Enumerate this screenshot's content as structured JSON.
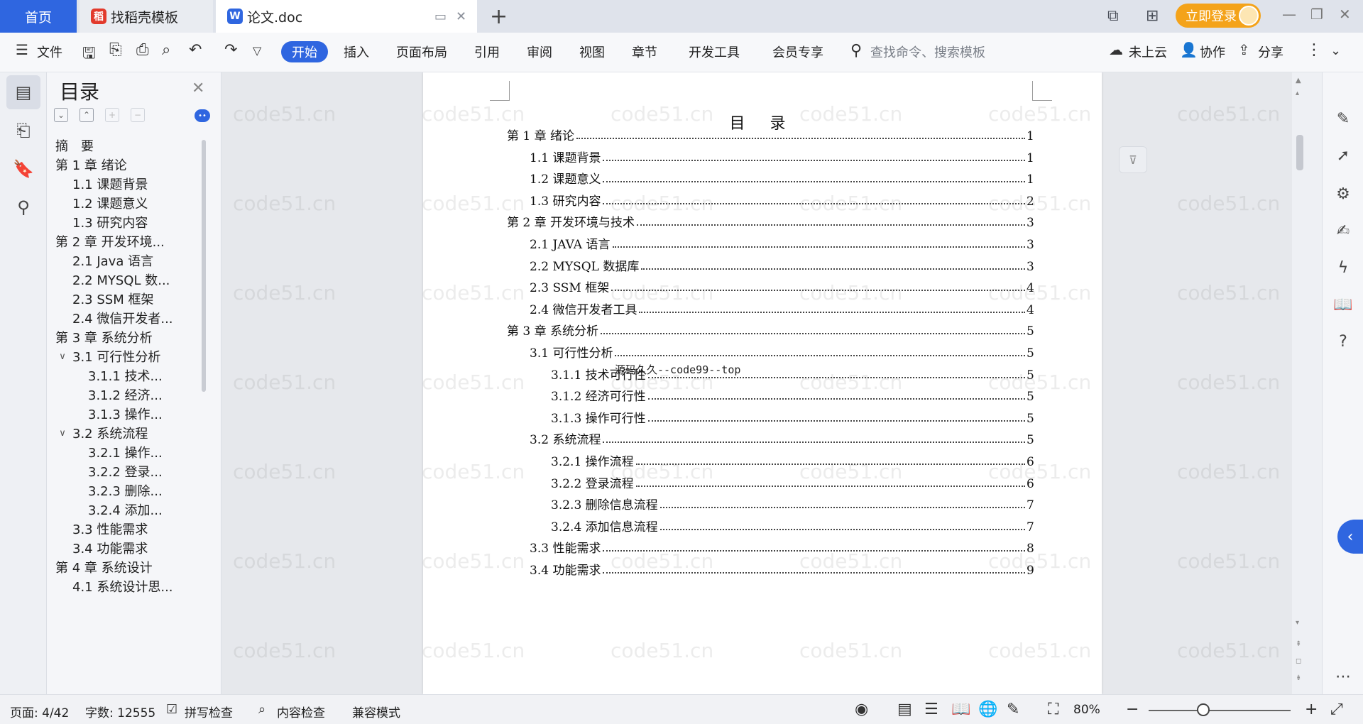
{
  "tabs": {
    "home": "首页",
    "template": "找稻壳模板",
    "doc": "论文.doc",
    "login": "立即登录"
  },
  "menu": {
    "file": "文件",
    "start": "开始",
    "insert": "插入",
    "layout": "页面布局",
    "reference": "引用",
    "review": "审阅",
    "view": "视图",
    "chapter": "章节",
    "devtools": "开发工具",
    "vip": "会员专享",
    "search_placeholder": "查找命令、搜索模板",
    "cloud": "未上云",
    "collab": "协作",
    "share": "分享"
  },
  "toc_panel": {
    "title": "目录",
    "items": [
      {
        "label": "摘　要",
        "level": 0,
        "chev": ""
      },
      {
        "label": "第 1 章  绪论",
        "level": 0,
        "chev": "v"
      },
      {
        "label": "1.1  课题背景",
        "level": 1,
        "chev": ""
      },
      {
        "label": "1.2  课题意义",
        "level": 1,
        "chev": ""
      },
      {
        "label": "1.3  研究内容",
        "level": 1,
        "chev": ""
      },
      {
        "label": "第 2 章  开发环境...",
        "level": 0,
        "chev": "v"
      },
      {
        "label": "2.1 Java 语言",
        "level": 1,
        "chev": ""
      },
      {
        "label": "2.2 MYSQL 数...",
        "level": 1,
        "chev": ""
      },
      {
        "label": "2.3 SSM 框架",
        "level": 1,
        "chev": ""
      },
      {
        "label": "2.4 微信开发者...",
        "level": 1,
        "chev": ""
      },
      {
        "label": "第 3 章  系统分析",
        "level": 0,
        "chev": "v"
      },
      {
        "label": "3.1  可行性分析",
        "level": 1,
        "chev": "v"
      },
      {
        "label": "3.1.1  技术...",
        "level": 2,
        "chev": ""
      },
      {
        "label": "3.1.2  经济...",
        "level": 2,
        "chev": ""
      },
      {
        "label": "3.1.3  操作...",
        "level": 2,
        "chev": ""
      },
      {
        "label": "3.2  系统流程",
        "level": 1,
        "chev": "v"
      },
      {
        "label": "3.2.1  操作...",
        "level": 2,
        "chev": ""
      },
      {
        "label": "3.2.2  登录...",
        "level": 2,
        "chev": ""
      },
      {
        "label": "3.2.3  删除...",
        "level": 2,
        "chev": ""
      },
      {
        "label": "3.2.4  添加...",
        "level": 2,
        "chev": ""
      },
      {
        "label": "3.3  性能需求",
        "level": 1,
        "chev": ""
      },
      {
        "label": "3.4  功能需求",
        "level": 1,
        "chev": ""
      },
      {
        "label": "第 4 章  系统设计",
        "level": 0,
        "chev": "v"
      },
      {
        "label": "4.1  系统设计思...",
        "level": 1,
        "chev": ""
      }
    ]
  },
  "document": {
    "title": "目  录",
    "stamp": "源码久久--code99--top",
    "entries": [
      {
        "text": "第 1 章  绪论",
        "page": "1",
        "level": 0
      },
      {
        "text": "1.1  课题背景",
        "page": "1",
        "level": 1
      },
      {
        "text": "1.2  课题意义",
        "page": "1",
        "level": 1
      },
      {
        "text": "1.3  研究内容",
        "page": "2",
        "level": 1
      },
      {
        "text": "第 2 章  开发环境与技术",
        "page": "3",
        "level": 0
      },
      {
        "text": "2.1 JAVA 语言",
        "page": "3",
        "level": 1
      },
      {
        "text": "2.2 MYSQL 数据库",
        "page": "3",
        "level": 1
      },
      {
        "text": "2.3 SSM 框架",
        "page": "4",
        "level": 1
      },
      {
        "text": "2.4 微信开发者工具",
        "page": "4",
        "level": 1
      },
      {
        "text": "第 3 章  系统分析",
        "page": "5",
        "level": 0
      },
      {
        "text": "3.1  可行性分析",
        "page": "5",
        "level": 1
      },
      {
        "text": "3.1.1  技术可行性",
        "page": "5",
        "level": 2
      },
      {
        "text": "3.1.2  经济可行性",
        "page": "5",
        "level": 2
      },
      {
        "text": "3.1.3  操作可行性",
        "page": "5",
        "level": 2
      },
      {
        "text": "3.2  系统流程",
        "page": "5",
        "level": 1
      },
      {
        "text": "3.2.1 操作流程",
        "page": "6",
        "level": 2
      },
      {
        "text": "3.2.2  登录流程",
        "page": "6",
        "level": 2
      },
      {
        "text": "3.2.3  删除信息流程",
        "page": "7",
        "level": 2
      },
      {
        "text": "3.2.4  添加信息流程",
        "page": "7",
        "level": 2
      },
      {
        "text": "3.3  性能需求",
        "page": "8",
        "level": 1
      },
      {
        "text": "3.4  功能需求",
        "page": "9",
        "level": 1
      }
    ]
  },
  "watermark": "code51.cn",
  "status": {
    "page": "页面: 4/42",
    "words": "字数: 12555",
    "spell": "拼写检查",
    "content_check": "内容检查",
    "compat": "兼容模式",
    "zoom": "80%"
  },
  "colors": {
    "accent": "#2f66e0",
    "login": "#f4a31a"
  }
}
